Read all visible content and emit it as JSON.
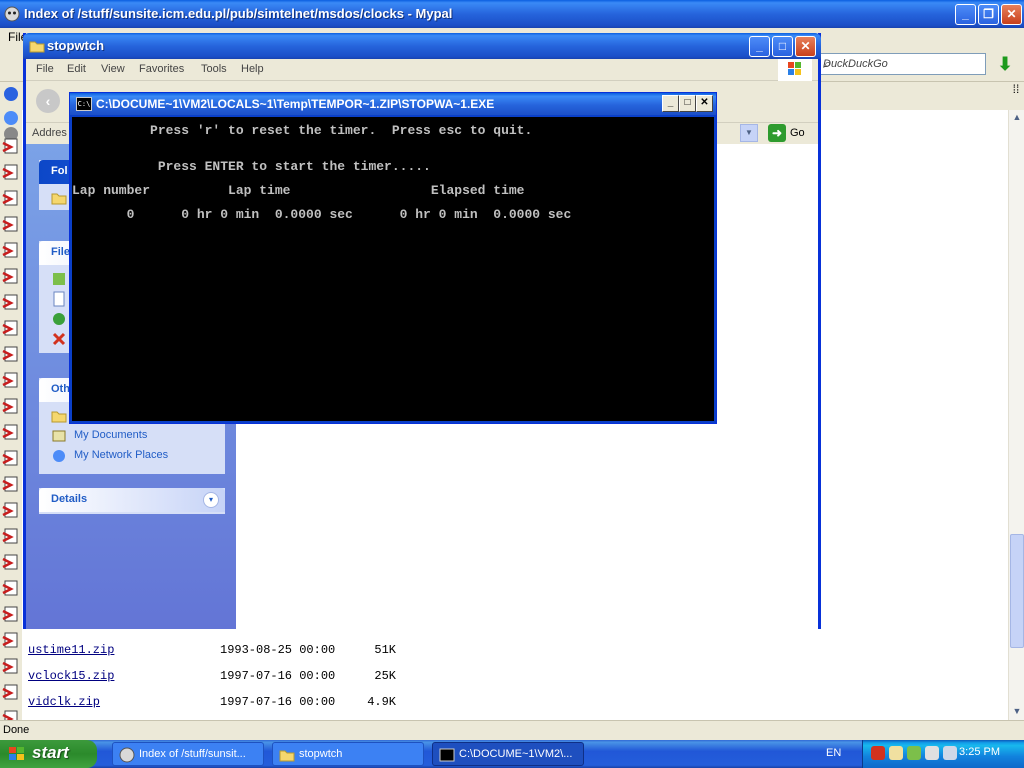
{
  "browser": {
    "title": "Index of /stuff/sunsite.icm.edu.pl/pub/simtelnet/msdos/clocks - Mypal",
    "menu_partial": "File",
    "search_placeholder": "DuckDuckGo",
    "status": "Done",
    "files": [
      {
        "name": "ustime11.zip",
        "date": "1993-08-25 00:00",
        "size": "51K"
      },
      {
        "name": "vclock15.zip",
        "date": "1997-07-16 00:00",
        "size": "25K"
      },
      {
        "name": "vidclk.zip",
        "date": "1997-07-16 00:00",
        "size": "4.9K"
      }
    ]
  },
  "explorer": {
    "title": "stopwtch",
    "menu": [
      "File",
      "Edit",
      "View",
      "Favorites",
      "Tools",
      "Help"
    ],
    "address_label": "Addres",
    "go_label": "Go",
    "tasks": {
      "folder_head": "Fol",
      "file_head": "File",
      "other_head": "Oth",
      "other_links": [
        "My Documents",
        "My Network Places"
      ],
      "details_head": "Details"
    }
  },
  "console": {
    "title": "C:\\DOCUME~1\\VM2\\LOCALS~1\\Temp\\TEMPOR~1.ZIP\\STOPWA~1.EXE",
    "lines": [
      "          Press 'r' to reset the timer.  Press esc to quit.",
      "           Press ENTER to start the timer.....",
      "Lap number          Lap time                  Elapsed time",
      "       0      0 hr 0 min  0.0000 sec      0 hr 0 min  0.0000 sec"
    ]
  },
  "taskbar": {
    "start_label": "start",
    "buttons": [
      {
        "label": "Index of /stuff/sunsit...",
        "icon": "mypal-icon",
        "active": false
      },
      {
        "label": "stopwtch",
        "icon": "folder-icon",
        "active": false
      },
      {
        "label": "C:\\DOCUME~1\\VM2\\...",
        "icon": "console-icon",
        "active": true
      }
    ],
    "language": "EN",
    "clock": "3:25 PM"
  }
}
